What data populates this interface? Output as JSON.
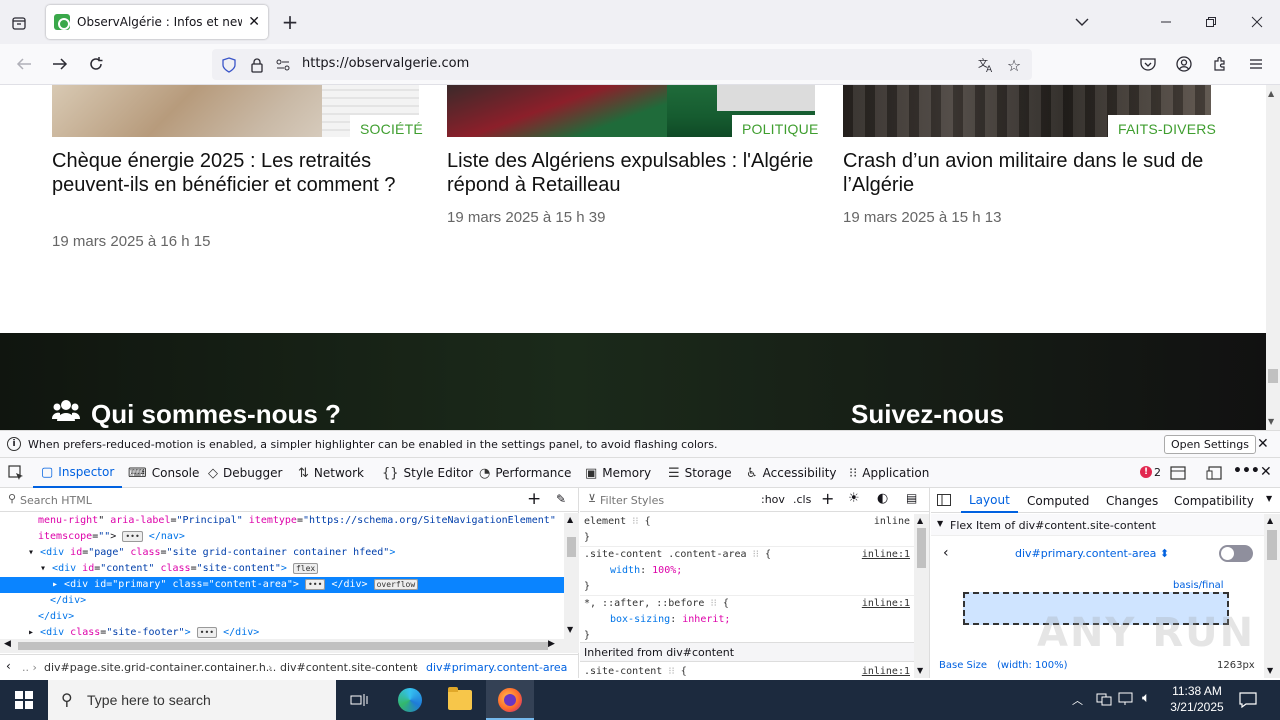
{
  "browser": {
    "tab_title": "ObservAlgérie : Infos et news p",
    "url": "https://observalgerie.com",
    "icons": [
      "tab-list-icon",
      "close-icon",
      "new-tab-icon",
      "tab-overflow-icon",
      "minimize-icon",
      "restore-icon",
      "window-close-icon",
      "back-icon",
      "forward-icon",
      "reload-icon",
      "shield-icon",
      "lock-icon",
      "permissions-icon",
      "translate-icon",
      "bookmark-star-icon",
      "pocket-icon",
      "account-icon",
      "extensions-icon",
      "menu-icon"
    ]
  },
  "articles": [
    {
      "category": "SOCIÉTÉ",
      "title": "Chèque énergie 2025 : Les retraités peuvent-ils en bénéficier et comment ?",
      "date": "19 mars 2025 à 16 h 15"
    },
    {
      "category": "POLITIQUE",
      "title": "Liste des Algériens expulsables : l'Algérie répond à Retailleau",
      "date": "19 mars 2025 à 15 h 39"
    },
    {
      "category": "FAITS-DIVERS",
      "title": "Crash d’un avion militaire dans le sud de l’Algérie",
      "date": "19 mars 2025 à 15 h 13"
    }
  ],
  "footer": {
    "about_title": "Qui sommes-nous ?",
    "follow_title": "Suivez-nous"
  },
  "notice": {
    "text": "When prefers-reduced-motion is enabled, a simpler highlighter can be enabled in the settings panel, to avoid flashing colors.",
    "button": "Open Settings"
  },
  "devtools": {
    "tabs": [
      "Inspector",
      "Console",
      "Debugger",
      "Network",
      "Style Editor",
      "Performance",
      "Memory",
      "Storage",
      "Accessibility",
      "Application"
    ],
    "error_count": "2",
    "search_placeholder": "Search HTML",
    "filter_placeholder": "Filter Styles",
    "hov": ":hov",
    "cls": ".cls",
    "breadcrumbs": [
      "div#page.site.grid-container.container.h...",
      "div#content.site-content",
      "div#primary.content-area"
    ],
    "html_lines": [
      {
        "indent": 38,
        "html": "<span class='attrn'>menu-right</span>\" <span class='attrn'>aria-label</span>=<span class='val'>\"Principal\"</span> <span class='attrn'>itemtype</span>=<span class='val'>\"https://schema.org/SiteNavigationElement\"</span>"
      },
      {
        "indent": 38,
        "html": "<span class='attrn'>itemscope</span>=<span class='val'>\"\"</span>&gt; <span class='badge'>•••</span> <span class='tag'>&lt;/nav&gt;</span>"
      },
      {
        "indent": 28,
        "html": "▾ <span class='tag'>&lt;div</span> <span class='attrn'>id</span>=<span class='val'>\"page\"</span> <span class='attrn'>class</span>=<span class='val'>\"site grid-container container hfeed\"</span><span class='tag'>&gt;</span>"
      },
      {
        "indent": 40,
        "html": "▾ <span class='tag'>&lt;div</span> <span class='attrn'>id</span>=<span class='val'>\"content\"</span> <span class='attrn'>class</span>=<span class='val'>\"site-content\"</span><span class='tag'>&gt;</span> <span class='badge'>flex</span>"
      },
      {
        "indent": 52,
        "html": "▸ <span class='tag'>&lt;div</span> <span class='attrn'>id</span>=<span class='val'>\"primary\"</span> <span class='attrn'>class</span>=<span class='val'>\"content-area\"</span><span class='tag'>&gt;</span> <span class='badge'>•••</span> <span class='tag'>&lt;/div&gt;</span> <span class='badge'>overflow</span>",
        "selected": true
      },
      {
        "indent": 50,
        "html": "<span class='tag'>&lt;/div&gt;</span>"
      },
      {
        "indent": 38,
        "html": "<span class='tag'>&lt;/div&gt;</span>"
      },
      {
        "indent": 28,
        "html": "▸ <span class='tag'>&lt;div</span> <span class='attrn'>class</span>=<span class='val'>\"site-footer\"</span><span class='tag'>&gt;</span> <span class='badge'>•••</span> <span class='tag'>&lt;/div&gt;</span>"
      }
    ],
    "rules": {
      "element_selector": "element",
      "inline_label": "inline",
      "rule1_selector": ".site-content .content-area",
      "rule1_src": "inline:1",
      "rule1_prop": "width",
      "rule1_val": "100%;",
      "rule2_selector": "*, ::after, ::before",
      "rule2_src": "inline:1",
      "rule2_prop": "box-sizing",
      "rule2_val": "inherit;",
      "inherited": "Inherited from div#content",
      "rule3_selector": ".site-content",
      "rule3_src": "inline:1"
    },
    "layout_tabs": [
      "Layout",
      "Computed",
      "Changes",
      "Compatibility"
    ],
    "flex_item_title": "Flex Item of div#content.site-content",
    "flex_item_selector": "div#primary.content-area",
    "basis_label": "basis/final",
    "base_size_label": "Base Size",
    "base_size_detail": "(width: 100%)",
    "base_size_value": "1263px"
  },
  "taskbar": {
    "search_placeholder": "Type here to search",
    "time": "11:38 AM",
    "date": "3/21/2025"
  },
  "watermark": "ANY RUN"
}
